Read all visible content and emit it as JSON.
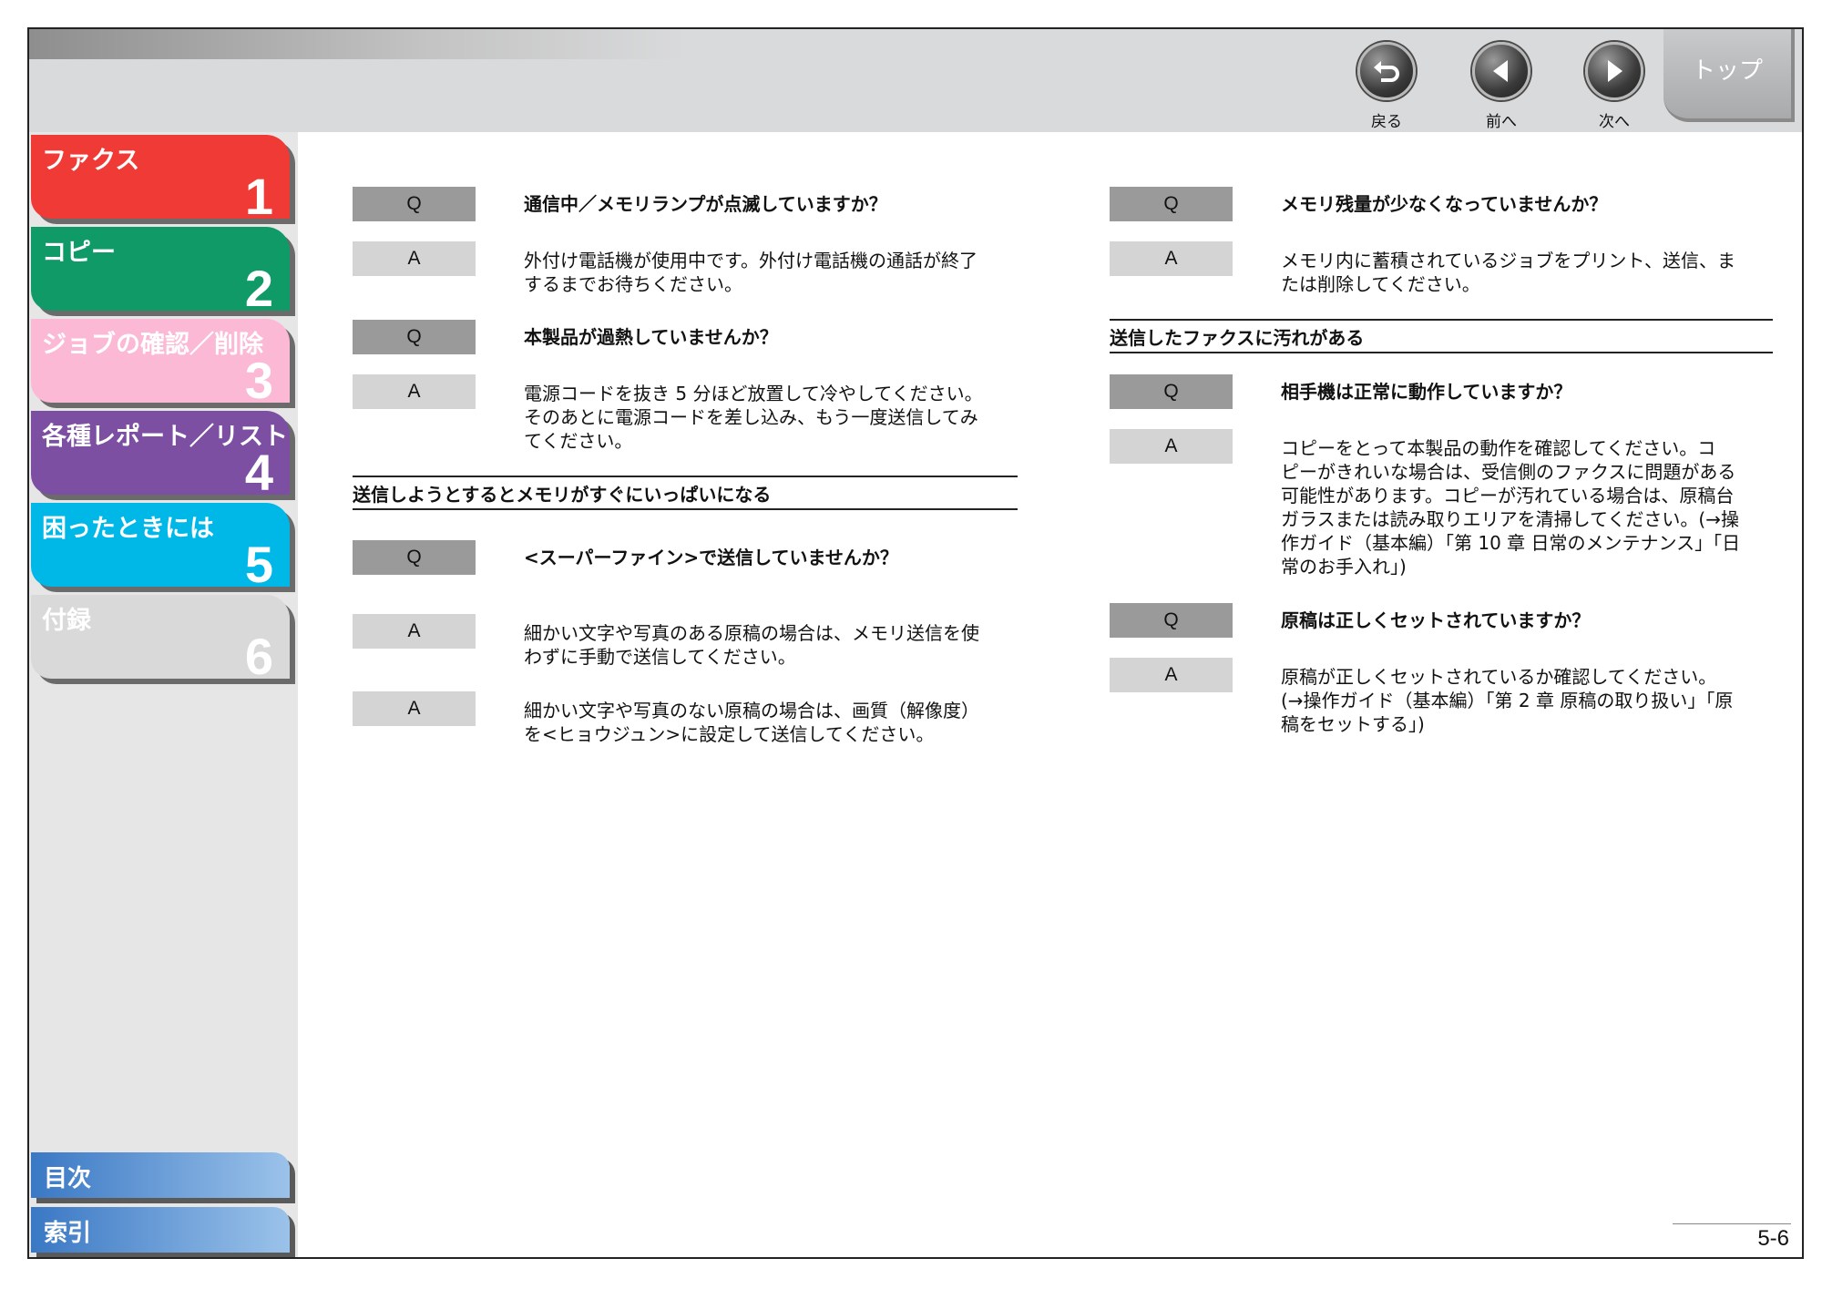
{
  "header": {
    "nav": [
      {
        "label": "戻る",
        "icon": "back-icon"
      },
      {
        "label": "前へ",
        "icon": "previous-icon"
      },
      {
        "label": "次へ",
        "icon": "next-icon"
      }
    ],
    "top_label": "トップ"
  },
  "sidebar": {
    "chapters": [
      {
        "label": "ファクス",
        "number": "1",
        "color": "#f03a36"
      },
      {
        "label": "コピー",
        "number": "2",
        "color": "#0f9a68"
      },
      {
        "label": "ジョブの確認／削除",
        "number": "3",
        "color": "#fbb9d5"
      },
      {
        "label": "各種レポート／リスト",
        "number": "4",
        "color": "#7c4fa2"
      },
      {
        "label": "困ったときには",
        "number": "5",
        "color": "#00b8e8"
      },
      {
        "label": "付録",
        "number": "6",
        "color": "#d9d9d9"
      }
    ],
    "contents_label": "目次",
    "index_label": "索引"
  },
  "left": {
    "q1": "通信中／メモリランプが点滅していますか？",
    "a1": [
      "外付け電話機が使用中です。外付け電話機の通話が終了",
      "するまでお待ちください。"
    ],
    "q2": "本製品が過熱していませんか？",
    "a2": [
      "電源コードを抜き 5 分ほど放置して冷やしてください。",
      "そのあとに電源コードを差し込み、もう一度送信してみ",
      "てください。"
    ],
    "section": "送信しようとするとメモリがすぐにいっぱいになる",
    "q3": "<スーパーファイン>で送信していませんか？",
    "a3": [
      "細かい文字や写真のある原稿の場合は、メモリ送信を使",
      "わずに手動で送信してください。"
    ],
    "a4": [
      "細かい文字や写真のない原稿の場合は、画質（解像度）",
      "を<ヒョウジュン>に設定して送信してください。"
    ]
  },
  "right": {
    "q1": "メモリ残量が少なくなっていませんか？",
    "a1": [
      "メモリ内に蓄積されているジョブをプリント、送信、ま",
      "たは削除してください。"
    ],
    "section": "送信したファクスに汚れがある",
    "q2": "相手機は正常に動作していますか？",
    "a2": [
      "コピーをとって本製品の動作を確認してください。コ",
      "ピーがきれいな場合は、受信側のファクスに問題がある",
      "可能性があります。コピーが汚れている場合は、原稿台",
      "ガラスまたは読み取りエリアを清掃してください。(→操",
      "作ガイド（基本編）「第 10 章 日常のメンテナンス」「日",
      "常のお手入れ」)"
    ],
    "q3": "原稿は正しくセットされていますか？",
    "a3": [
      "原稿が正しくセットされているか確認してください。",
      "(→操作ガイド（基本編）「第 2 章 原稿の取り扱い」「原",
      "稿をセットする」)"
    ]
  },
  "badges": {
    "q": "Q",
    "a": "A"
  },
  "page_number": "5-6"
}
